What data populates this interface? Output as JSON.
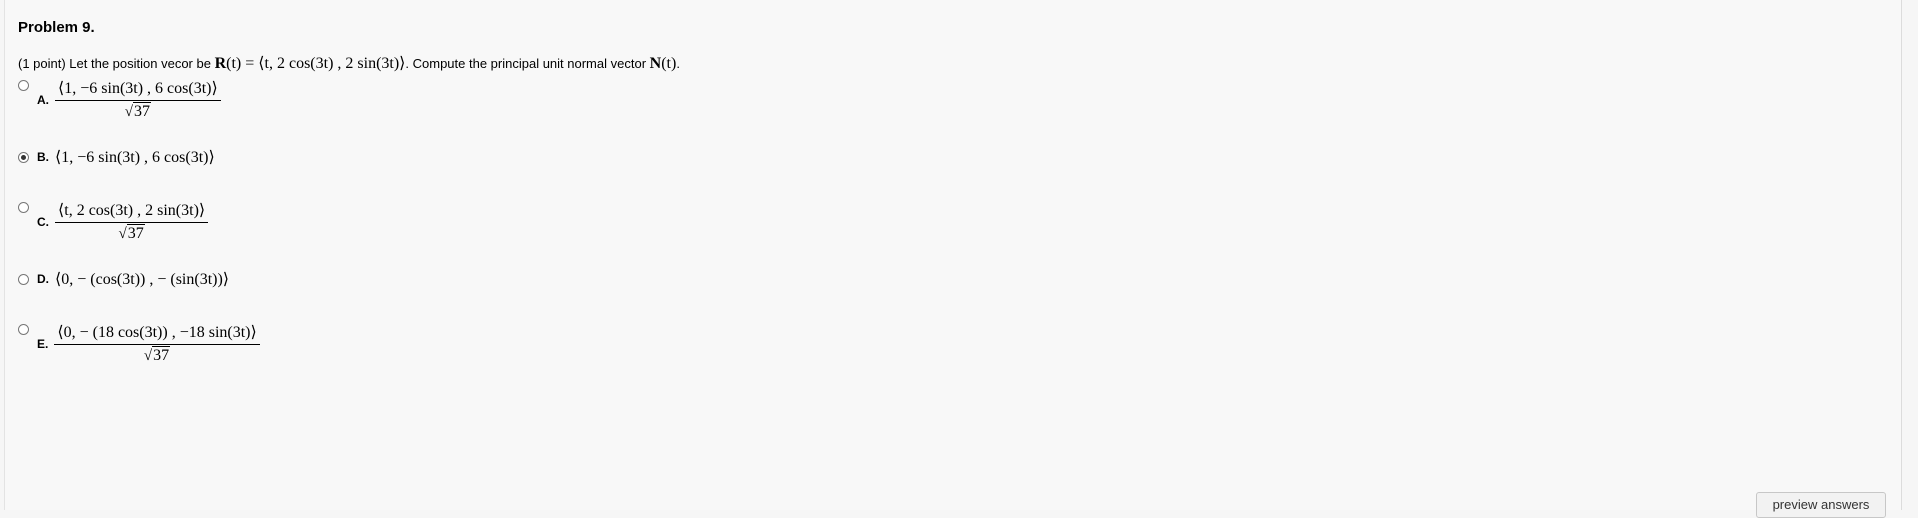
{
  "problem": {
    "title": "Problem 9.",
    "points": "(1 point) Let the position vecor be",
    "def_lhs": "R",
    "def_arg": "(t)",
    "def_rhs": " = ⟨t, 2 cos(3t) , 2 sin(3t)⟩",
    "instruction": ". Compute the principal unit normal vector",
    "normal_sym": "N",
    "normal_arg": "(t)",
    "end_punct": "."
  },
  "options": [
    {
      "letter": "A.",
      "numerator": "⟨1, −6 sin(3t) , 6 cos(3t)⟩",
      "denominator": "37",
      "selected": false
    },
    {
      "letter": "B.",
      "expression": "⟨1, −6 sin(3t) , 6 cos(3t)⟩",
      "selected": true
    },
    {
      "letter": "C.",
      "numerator": "⟨t, 2 cos(3t) , 2 sin(3t)⟩",
      "denominator": "37",
      "selected": false
    },
    {
      "letter": "D.",
      "expression": "⟨0, − (cos(3t)) , − (sin(3t))⟩",
      "selected": false
    },
    {
      "letter": "E.",
      "numerator": "⟨0, − (18 cos(3t)) , −18 sin(3t)⟩",
      "denominator": "37",
      "selected": false
    }
  ],
  "buttons": {
    "preview": "preview answers"
  },
  "sqrt_symbol": "√"
}
